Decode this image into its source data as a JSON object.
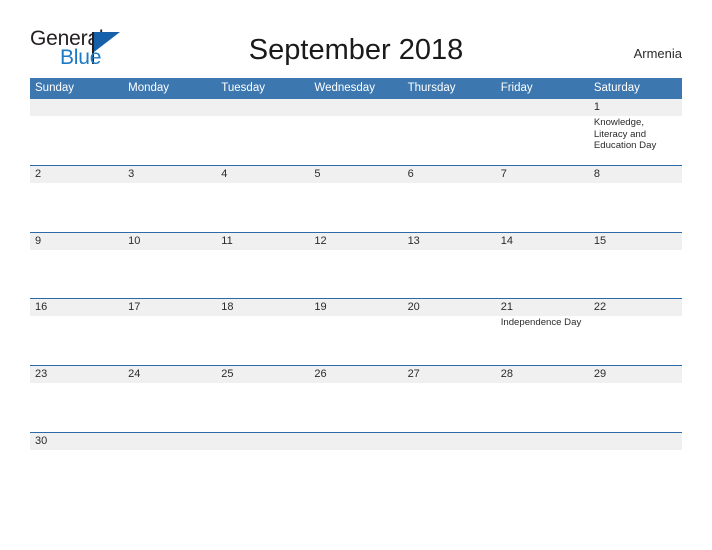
{
  "brand": {
    "word_one": "General",
    "word_two": "Blue",
    "triangle_icon": "triangle-icon",
    "accent_color": "#1560a8",
    "text_color": "#231f20"
  },
  "header": {
    "title": "September 2018",
    "region": "Armenia"
  },
  "calendar": {
    "header_bg_color": "#3c77b0",
    "row_border_color": "#2c6aa8",
    "date_strip_color": "#f0f0f0",
    "weekdays": [
      "Sunday",
      "Monday",
      "Tuesday",
      "Wednesday",
      "Thursday",
      "Friday",
      "Saturday"
    ],
    "weeks": [
      [
        {
          "date": "",
          "event": ""
        },
        {
          "date": "",
          "event": ""
        },
        {
          "date": "",
          "event": ""
        },
        {
          "date": "",
          "event": ""
        },
        {
          "date": "",
          "event": ""
        },
        {
          "date": "",
          "event": ""
        },
        {
          "date": "1",
          "event": "Knowledge, Literacy and Education Day"
        }
      ],
      [
        {
          "date": "2",
          "event": ""
        },
        {
          "date": "3",
          "event": ""
        },
        {
          "date": "4",
          "event": ""
        },
        {
          "date": "5",
          "event": ""
        },
        {
          "date": "6",
          "event": ""
        },
        {
          "date": "7",
          "event": ""
        },
        {
          "date": "8",
          "event": ""
        }
      ],
      [
        {
          "date": "9",
          "event": ""
        },
        {
          "date": "10",
          "event": ""
        },
        {
          "date": "11",
          "event": ""
        },
        {
          "date": "12",
          "event": ""
        },
        {
          "date": "13",
          "event": ""
        },
        {
          "date": "14",
          "event": ""
        },
        {
          "date": "15",
          "event": ""
        }
      ],
      [
        {
          "date": "16",
          "event": ""
        },
        {
          "date": "17",
          "event": ""
        },
        {
          "date": "18",
          "event": ""
        },
        {
          "date": "19",
          "event": ""
        },
        {
          "date": "20",
          "event": ""
        },
        {
          "date": "21",
          "event": "Independence Day"
        },
        {
          "date": "22",
          "event": ""
        }
      ],
      [
        {
          "date": "23",
          "event": ""
        },
        {
          "date": "24",
          "event": ""
        },
        {
          "date": "25",
          "event": ""
        },
        {
          "date": "26",
          "event": ""
        },
        {
          "date": "27",
          "event": ""
        },
        {
          "date": "28",
          "event": ""
        },
        {
          "date": "29",
          "event": ""
        }
      ],
      [
        {
          "date": "30",
          "event": ""
        },
        {
          "date": "",
          "event": ""
        },
        {
          "date": "",
          "event": ""
        },
        {
          "date": "",
          "event": ""
        },
        {
          "date": "",
          "event": ""
        },
        {
          "date": "",
          "event": ""
        },
        {
          "date": "",
          "event": ""
        }
      ]
    ]
  }
}
